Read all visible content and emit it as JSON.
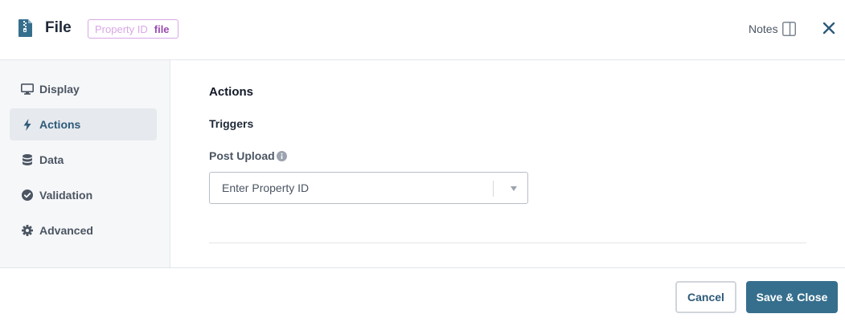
{
  "header": {
    "title": "File",
    "icon": "file-zip-icon",
    "property_badge": {
      "label": "Property ID",
      "value": "file"
    },
    "notes_label": "Notes",
    "notes_icon": "panel-toggle-icon",
    "close_icon": "close-icon"
  },
  "sidebar": {
    "items": [
      {
        "label": "Display",
        "icon": "monitor-icon",
        "active": false
      },
      {
        "label": "Actions",
        "icon": "lightning-icon",
        "active": true
      },
      {
        "label": "Data",
        "icon": "database-icon",
        "active": false
      },
      {
        "label": "Validation",
        "icon": "check-circle-icon",
        "active": false
      },
      {
        "label": "Advanced",
        "icon": "gear-icon",
        "active": false
      }
    ]
  },
  "main": {
    "section_title": "Actions",
    "subsection_title": "Triggers",
    "post_upload": {
      "label": "Post Upload",
      "info_icon": "info-icon",
      "placeholder": "Enter Property ID"
    }
  },
  "footer": {
    "cancel_label": "Cancel",
    "save_label": "Save & Close"
  },
  "colors": {
    "accent": "#366f8d",
    "active_text": "#2d5a7a",
    "badge_border": "#d9a7e6",
    "badge_value": "#9b4bb0",
    "sidebar_bg": "#f6f7f9",
    "sidebar_active_bg": "#e6e9ed"
  }
}
